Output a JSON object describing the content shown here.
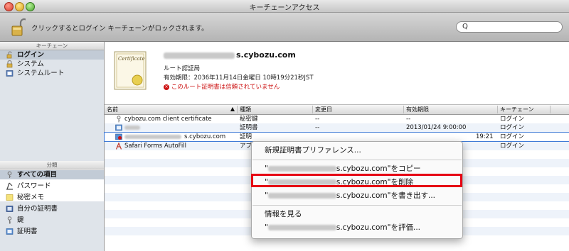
{
  "window": {
    "title": "キーチェーンアクセス"
  },
  "toolbar": {
    "lock_text": "クリックするとログイン キーチェーンがロックされます。",
    "search_placeholder": ""
  },
  "sidebar": {
    "keychain_header": "キーチェーン",
    "keychains": [
      {
        "label": "ログイン",
        "icon": "login-keychain-icon"
      },
      {
        "label": "システム",
        "icon": "system-keychain-icon"
      },
      {
        "label": "システムルート",
        "icon": "system-root-icon"
      }
    ],
    "category_header": "分類",
    "categories": [
      {
        "label": "すべての項目",
        "icon": "all-items-icon"
      },
      {
        "label": "パスワード",
        "icon": "password-icon"
      },
      {
        "label": "秘密メモ",
        "icon": "secure-note-icon"
      },
      {
        "label": "自分の証明書",
        "icon": "my-certificate-icon"
      },
      {
        "label": "鍵",
        "icon": "key-icon"
      },
      {
        "label": "証明書",
        "icon": "certificate-icon"
      }
    ]
  },
  "cert": {
    "name": "s.cybozu.com",
    "type": "ルート認証局",
    "expiry": "有効期限：2036年11月14日金曜日 10時19分21秒JST",
    "warning": "このルート証明書は信頼されていません",
    "badge_text": "Certificate"
  },
  "table": {
    "headers": [
      "名前",
      "種類",
      "変更日",
      "有効期限",
      "キーチェーン"
    ],
    "sort_indicator": "▲",
    "rows": [
      {
        "name": "cybozu.com client certificate",
        "kind": "秘密鍵",
        "modified": "--",
        "expires": "--",
        "keychain": "ログイン"
      },
      {
        "name": "",
        "kind": "証明書",
        "modified": "--",
        "expires": "2013/01/24 9:00:00",
        "keychain": "ログイン"
      },
      {
        "name": "s.cybozu.com",
        "kind": "証明",
        "modified": "",
        "expires": "19:21",
        "keychain": "ログイン"
      },
      {
        "name": "Safari Forms AutoFill",
        "kind": "アプ",
        "modified": "",
        "expires": "",
        "keychain": "ログイン"
      }
    ]
  },
  "menu": {
    "items": [
      {
        "label": "新規証明書プリファレンス..."
      },
      {
        "label": "s.cybozu.com\"をコピー"
      },
      {
        "label": "s.cybozu.com\"を削除"
      },
      {
        "label": "s.cybozu.com\"を書き出す..."
      },
      {
        "label": "情報を見る"
      },
      {
        "label": "s.cybozu.com\"を評価..."
      }
    ],
    "quote_open": "\""
  },
  "colors": {
    "highlight": "#e60012",
    "warning": "#cc1111",
    "selection": "#3f7ad6"
  }
}
